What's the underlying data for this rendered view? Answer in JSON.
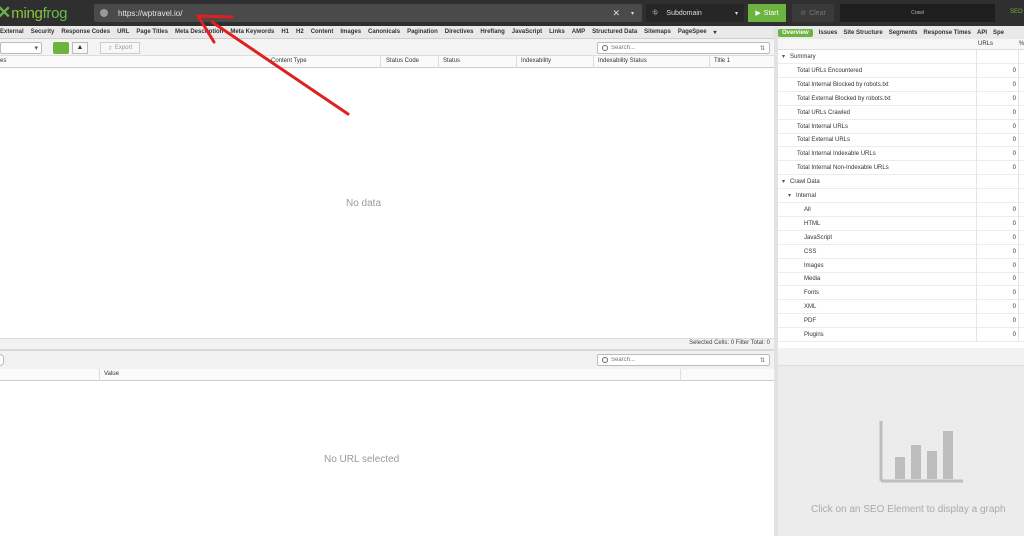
{
  "app": {
    "logo_mark": "✕",
    "logo_text_a": "ming",
    "logo_text_b": "frog",
    "seo_label": "SEO"
  },
  "top": {
    "url_value": "https://wptravel.io/",
    "clear_icon": "✕",
    "dropdown_icon": "▾",
    "mode_label": "Subdomain",
    "start_label": "Start",
    "clear_label": "Clear",
    "crawl_label": "Crawl"
  },
  "tabs": [
    "External",
    "Security",
    "Response Codes",
    "URL",
    "Page Titles",
    "Meta Description",
    "Meta Keywords",
    "H1",
    "H2",
    "Content",
    "Images",
    "Canonicals",
    "Pagination",
    "Directives",
    "Hreflang",
    "JavaScript",
    "Links",
    "AMP",
    "Structured Data",
    "Sitemaps",
    "PageSpee",
    "▾"
  ],
  "right_tabs": [
    "Overview",
    "Issues",
    "Site Structure",
    "Segments",
    "Response Times",
    "API",
    "Spe"
  ],
  "toolbar": {
    "export_label": "Export",
    "search_placeholder": "Search...",
    "search_opt": "⇅"
  },
  "grid": {
    "columns": [
      "es",
      "Content Type",
      "Status Code",
      "Status",
      "Indexability",
      "Indexability Status",
      "Title 1"
    ],
    "empty_text": "No data"
  },
  "statusbar": {
    "text": "Selected Cells:  0  Filter Total:  0"
  },
  "lower": {
    "search_placeholder": "Search...",
    "columns": [
      "Value"
    ],
    "empty_text": "No URL selected"
  },
  "right_panel": {
    "col_urls": "URLs",
    "col_pct": "%",
    "rows": [
      {
        "label": "Summary",
        "value": "",
        "indent": 1,
        "toggle": "▾"
      },
      {
        "label": "Total URLs Encountered",
        "value": "0",
        "indent": 2
      },
      {
        "label": "Total Internal Blocked by robots.txt",
        "value": "0",
        "indent": 2
      },
      {
        "label": "Total External Blocked by robots.txt",
        "value": "0",
        "indent": 2
      },
      {
        "label": "Total URLs Crawled",
        "value": "0",
        "indent": 2
      },
      {
        "label": "Total Internal URLs",
        "value": "0",
        "indent": 2
      },
      {
        "label": "Total External URLs",
        "value": "0",
        "indent": 2
      },
      {
        "label": "Total Internal Indexable URLs",
        "value": "0",
        "indent": 2
      },
      {
        "label": "Total Internal Non-Indexable URLs",
        "value": "0",
        "indent": 2
      },
      {
        "label": "Crawl Data",
        "value": "",
        "indent": 1,
        "toggle": "▾"
      },
      {
        "label": "Internal",
        "value": "",
        "indent": 2,
        "toggle": "▾"
      },
      {
        "label": "All",
        "value": "0",
        "indent": 3
      },
      {
        "label": "HTML",
        "value": "0",
        "indent": 3
      },
      {
        "label": "JavaScript",
        "value": "0",
        "indent": 3
      },
      {
        "label": "CSS",
        "value": "0",
        "indent": 3
      },
      {
        "label": "Images",
        "value": "0",
        "indent": 3
      },
      {
        "label": "Media",
        "value": "0",
        "indent": 3
      },
      {
        "label": "Fonts",
        "value": "0",
        "indent": 3
      },
      {
        "label": "XML",
        "value": "0",
        "indent": 3
      },
      {
        "label": "PDF",
        "value": "0",
        "indent": 3
      },
      {
        "label": "Plugins",
        "value": "0",
        "indent": 3
      }
    ],
    "graph_hint": "Click on an SEO Element to display a graph"
  },
  "colors": {
    "accent": "#6cb33f",
    "topbar": "#2f2f2f",
    "arrow": "#e02020"
  }
}
